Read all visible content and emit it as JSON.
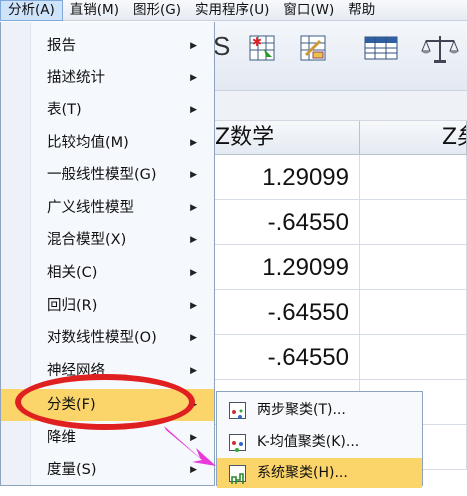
{
  "menubar": {
    "items": [
      "分析(A)",
      "直销(M)",
      "图形(G)",
      "实用程序(U)",
      "窗口(W)",
      "帮助"
    ]
  },
  "toolbar": {
    "partial_glyph": "S"
  },
  "grid": {
    "headers": [
      "Z数学",
      "Z矣"
    ],
    "values": [
      "1.29099",
      "-.64550",
      "1.29099",
      "-.64550",
      "-.64550"
    ]
  },
  "analyze_menu": {
    "items": [
      "报告",
      "描述统计",
      "表(T)",
      "比较均值(M)",
      "一般线性模型(G)",
      "广义线性模型",
      "混合模型(X)",
      "相关(C)",
      "回归(R)",
      "对数线性模型(O)",
      "神经网络",
      "分类(F)",
      "降维",
      "度量(S)"
    ],
    "submenu_arrow": "▶"
  },
  "classify_submenu": {
    "items": [
      "两步聚类(T)...",
      "K-均值聚类(K)...",
      "系统聚类(H)..."
    ]
  },
  "colors": {
    "highlight": "#fbd56a",
    "annotation_red": "#e02020",
    "annotation_arrow": "#e83ad9"
  }
}
